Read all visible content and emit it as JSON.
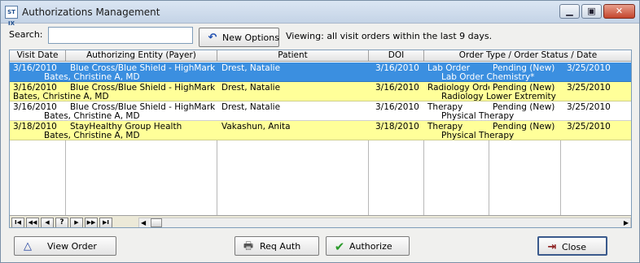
{
  "window": {
    "title": "Authorizations Management",
    "app_icon": "ST IX",
    "controls": {
      "minimize": "▁",
      "maximize": "▣",
      "close": "✕"
    }
  },
  "toolbar": {
    "search_label": "Search:",
    "search_value": "",
    "new_options_label": "New Options",
    "viewing_text": "Viewing: all visit orders within the last 9 days."
  },
  "grid": {
    "columns": [
      "Visit Date",
      "Authorizing Entity (Payer)",
      "Patient",
      "DOI",
      "Order Type / Order Status / Date"
    ],
    "rows": [
      {
        "style": "selected",
        "visit_date": "3/16/2010",
        "payer": "Blue Cross/Blue Shield - HighMark",
        "patient": "Drest, Natalie",
        "doi": "3/16/2010",
        "order_type": "Lab Order",
        "status": "Pending (New)",
        "date": "3/25/2010",
        "provider": "Bates, Christine A, MD",
        "order_detail": "Lab Order Chemistry*"
      },
      {
        "style": "yellow",
        "visit_date": "3/16/2010",
        "payer": "Blue Cross/Blue Shield - HighMark",
        "patient": "Drest, Natalie",
        "doi": "3/16/2010",
        "order_type": "Radiology Order",
        "status": "Pending (New)",
        "date": "3/25/2010",
        "provider": "Bates, Christine A, MD",
        "order_detail": "Radiology Lower Extremity"
      },
      {
        "style": "white",
        "visit_date": "3/16/2010",
        "payer": "Blue Cross/Blue Shield - HighMark",
        "patient": "Drest, Natalie",
        "doi": "3/16/2010",
        "order_type": "Therapy",
        "status": "Pending (New)",
        "date": "3/25/2010",
        "provider": "Bates, Christine A, MD",
        "order_detail": "Physical Therapy"
      },
      {
        "style": "yellow",
        "visit_date": "3/18/2010",
        "payer": "StayHealthy Group Health",
        "patient": "Vakashun, Anita",
        "doi": "3/18/2010",
        "order_type": "Therapy",
        "status": "Pending (New)",
        "date": "3/25/2010",
        "provider": "Bates, Christine A, MD",
        "order_detail": "Physical Therapy"
      }
    ],
    "navigator": {
      "first": "I◀",
      "prev_page": "◀◀",
      "prev": "◀",
      "help": "?",
      "next": "▶",
      "next_page": "▶▶",
      "last": "▶I"
    }
  },
  "buttons": {
    "view_order": "View Order",
    "req_auth": "Req Auth",
    "authorize": "Authorize",
    "close": "Close"
  },
  "icons": {
    "view_order_icon": "triangle-outline",
    "req_auth_icon": "printer",
    "authorize_icon": "green-checkmark",
    "close_icon": "exit-door",
    "new_options_icon": "blue-curved-arrow"
  },
  "colors": {
    "selected_row": "#3b8fe0",
    "highlight_row": "#ffff99"
  }
}
